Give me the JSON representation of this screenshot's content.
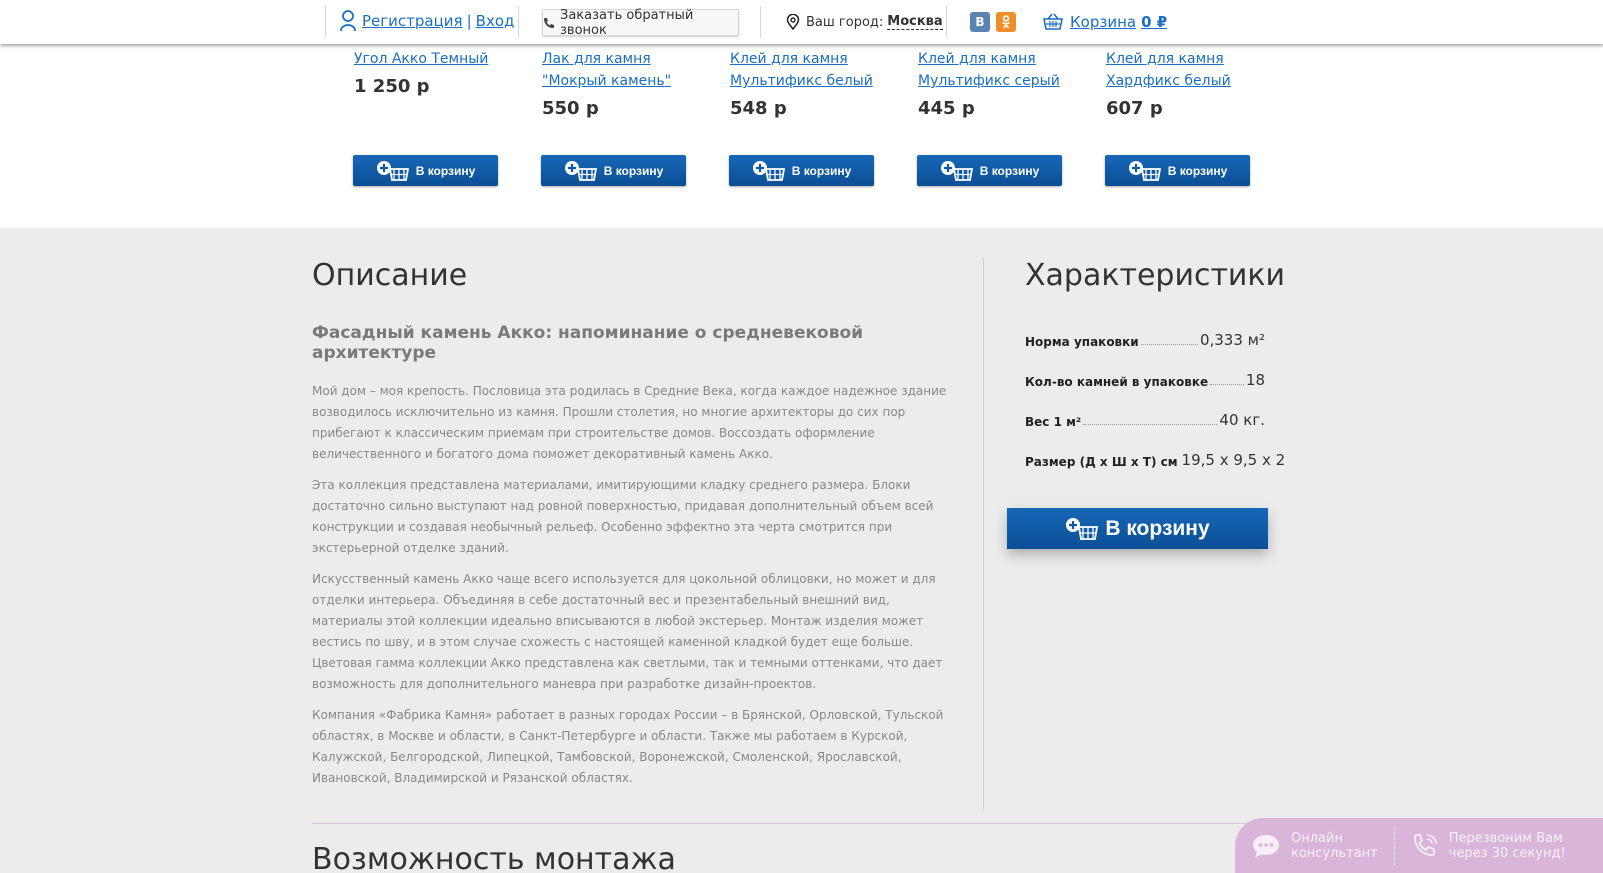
{
  "header": {
    "register": "Регистрация",
    "separator": "|",
    "login": "Вход",
    "callback": "Заказать обратный звонок",
    "city_label": "Ваш город:",
    "city": "Москва",
    "social_vk": "В",
    "social_ok": "ОК",
    "cart_label": "Корзина",
    "cart_sum": "0 ₽"
  },
  "products": [
    {
      "name": "Угол Акко Темный",
      "price": "1 250 р",
      "button": "В корзину"
    },
    {
      "name": "Лак для камня \"Мокрый камень\"",
      "price": "550 р",
      "button": "В корзину"
    },
    {
      "name": "Клей для камня Мультификс белый",
      "price": "548 р",
      "button": "В корзину"
    },
    {
      "name": "Клей для камня Мультификс серый",
      "price": "445 р",
      "button": "В корзину"
    },
    {
      "name": "Клей для камня Хардфикс белый",
      "price": "607 р",
      "button": "В корзину"
    }
  ],
  "description": {
    "title": "Описание",
    "subtitle": "Фасадный камень Акко: напоминание о средневековой архитектуре",
    "paragraphs": [
      "Мой дом – моя крепость. Пословица эта родилась в Средние Века, когда каждое надежное здание возводилось исключительно из камня. Прошли столетия, но многие архитекторы до сих пор прибегают к классическим приемам при строительстве домов. Воссоздать оформление величественного и богатого дома поможет декоративный камень Акко.",
      "Эта коллекция представлена материалами, имитирующими кладку среднего размера. Блоки достаточно сильно выступают над ровной поверхностью, придавая дополнительный объем всей конструкции и создавая необычный рельеф. Особенно эффектно эта черта смотрится при экстерьерной отделке зданий.",
      "Искусственный камень Акко чаще всего используется для цокольной облицовки, но может и для отделки интерьера. Объединяя в себе достаточный вес и презентабельный внешний вид, материалы этой коллекции идеально вписываются в любой экстерьер. Монтаж изделия может вестись по шву, и в этом случае схожесть с настоящей каменной кладкой будет еще больше. Цветовая гамма коллекции Акко представлена как светлыми, так и темными оттенками, что дает возможность для дополнительного маневра при разработке дизайн-проектов.",
      "Компания «Фабрика Камня» работает в разных городах России – в Брянской, Орловской, Тульской областях, в Москве и области, в Санкт-Петербурге и области. Также мы работаем в Курской, Калужской, Белгородской, Липецкой, Тамбовской, Воронежской, Смоленской, Ярославской, Ивановской, Владимирской и Рязанской областях."
    ]
  },
  "characteristics": {
    "title": "Характеристики",
    "rows": [
      {
        "key": "Норма упаковки",
        "value": "0,333 м²"
      },
      {
        "key": "Кол-во камней в упаковке",
        "value": "18"
      },
      {
        "key": "Вес 1 м²",
        "value": "40 кг."
      },
      {
        "key": "Размер (Д х Ш х Т) см",
        "value": "19,5 х 9,5 х 2"
      }
    ],
    "button": "В корзину"
  },
  "montage_title": "Возможность монтажа",
  "widget": {
    "online_line1": "Онлайн",
    "online_line2": "консультант",
    "callback_line1": "Перезвоним Вам",
    "callback_line2": "через 30 секунд!"
  },
  "colors": {
    "link": "#1a6fc2",
    "button": "#0b5aa8",
    "widget": "#d9b6d9"
  }
}
